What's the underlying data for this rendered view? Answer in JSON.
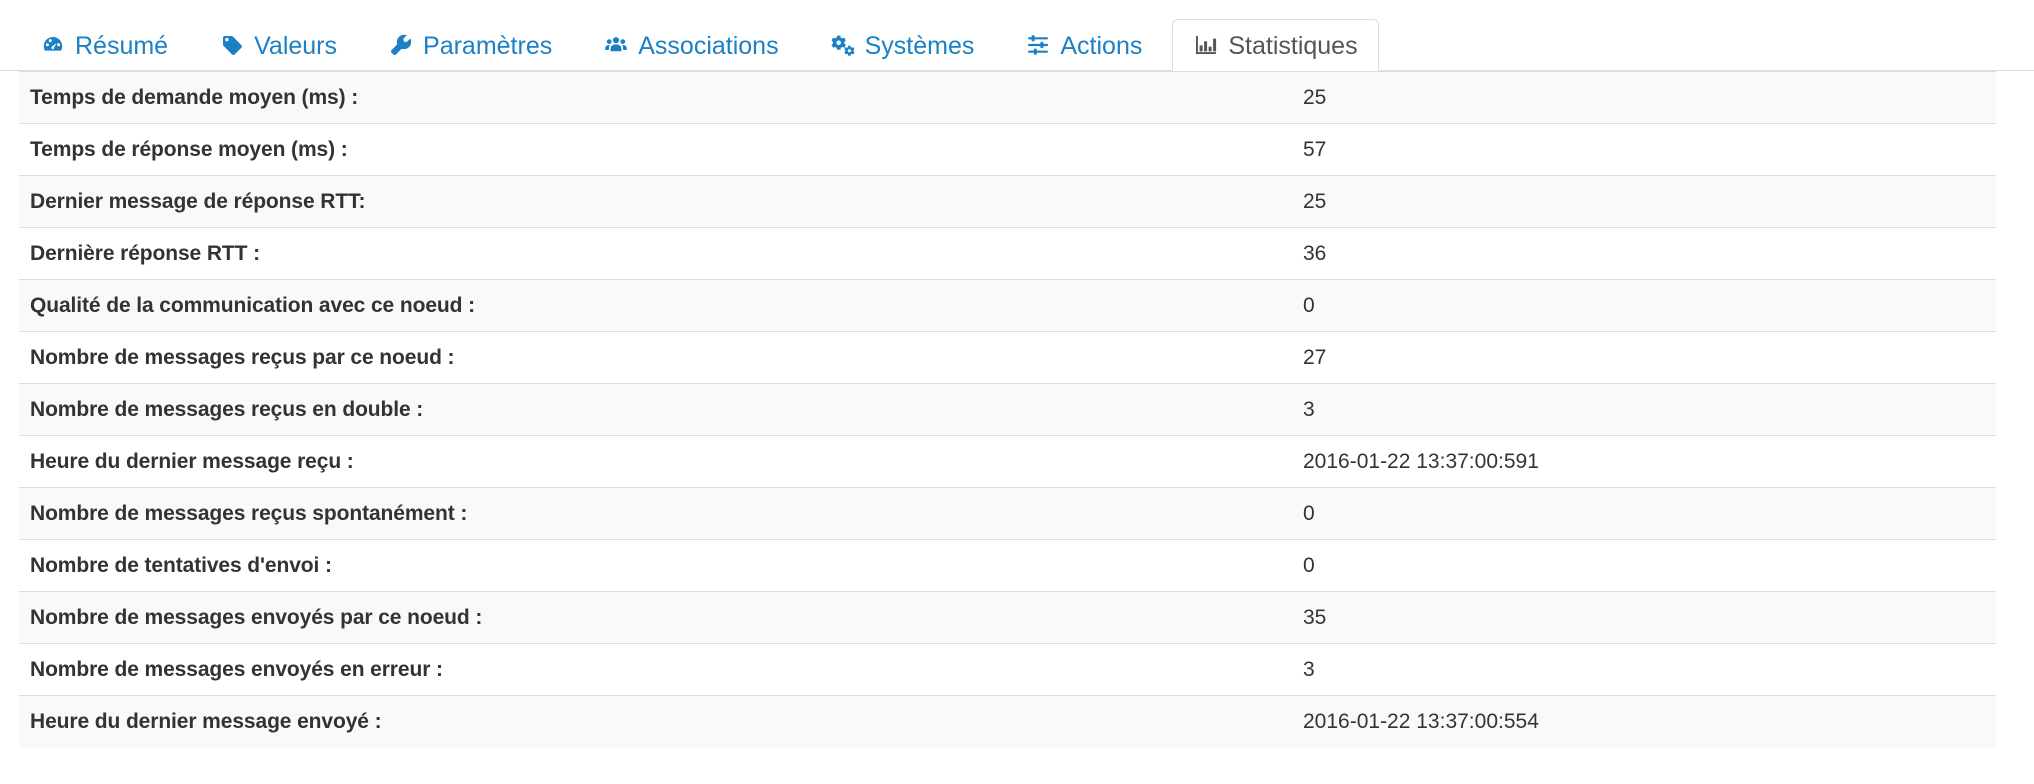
{
  "tabs": [
    {
      "id": "resume",
      "label": "Résumé",
      "icon": "dashboard-icon",
      "active": false
    },
    {
      "id": "valeurs",
      "label": "Valeurs",
      "icon": "tag-icon",
      "active": false
    },
    {
      "id": "parametres",
      "label": "Paramètres",
      "icon": "wrench-icon",
      "active": false
    },
    {
      "id": "associations",
      "label": "Associations",
      "icon": "users-icon",
      "active": false
    },
    {
      "id": "systemes",
      "label": "Systèmes",
      "icon": "cogs-icon",
      "active": false
    },
    {
      "id": "actions",
      "label": "Actions",
      "icon": "sliders-icon",
      "active": false
    },
    {
      "id": "statistiques",
      "label": "Statistiques",
      "icon": "bar-chart-icon",
      "active": true
    }
  ],
  "colors": {
    "link_blue": "#1b80c4",
    "active_tab_text": "#555555",
    "border": "#dddddd",
    "stripe": "#f9f9f9",
    "text": "#333333"
  },
  "stats_table": {
    "rows": [
      {
        "label": "Temps de demande moyen (ms) :",
        "value": "25"
      },
      {
        "label": "Temps de réponse moyen (ms) :",
        "value": "57"
      },
      {
        "label": "Dernier message de réponse RTT:",
        "value": "25"
      },
      {
        "label": "Dernière réponse RTT :",
        "value": "36"
      },
      {
        "label": "Qualité de la communication avec ce noeud :",
        "value": "0"
      },
      {
        "label": "Nombre de messages reçus par ce noeud :",
        "value": "27"
      },
      {
        "label": "Nombre de messages reçus en double :",
        "value": "3"
      },
      {
        "label": "Heure du dernier message reçu :",
        "value": "2016-01-22 13:37:00:591"
      },
      {
        "label": "Nombre de messages reçus spontanément :",
        "value": "0"
      },
      {
        "label": "Nombre de tentatives d'envoi :",
        "value": "0"
      },
      {
        "label": "Nombre de messages envoyés par ce noeud :",
        "value": "35"
      },
      {
        "label": "Nombre de messages envoyés en erreur :",
        "value": "3"
      },
      {
        "label": "Heure du dernier message envoyé :",
        "value": "2016-01-22 13:37:00:554"
      }
    ]
  }
}
